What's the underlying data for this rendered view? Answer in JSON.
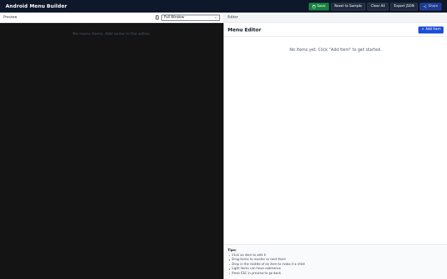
{
  "app": {
    "title": "Android Menu Builder"
  },
  "toolbar": {
    "save": "Save",
    "reset": "Reset to Sample",
    "clear": "Clear All",
    "export": "Export JSON",
    "share": "Share"
  },
  "preview": {
    "header": "Preview",
    "size_select": "Full Window",
    "empty": "No menu items. Add some in the editor."
  },
  "editor": {
    "header": "Editor",
    "title": "Menu Editor",
    "add_button": "Add Item",
    "empty": "No items yet. Click \"Add Item\" to get started."
  },
  "tips": {
    "title": "Tips:",
    "items": [
      "Click an item to edit it",
      "Drag items to reorder or nest them",
      "Drop in the middle of an item to make it a child",
      "Light items can have submenus",
      "Press ESC in preview to go back"
    ]
  },
  "icons": {
    "save": "floppy-disk-icon",
    "share": "share-icon",
    "device": "phone-icon",
    "add": "plus-icon"
  },
  "colors": {
    "topbar": "#0f172a",
    "save": "#15803d",
    "primary": "#1d4ed8",
    "preview_bg": "#141414"
  }
}
